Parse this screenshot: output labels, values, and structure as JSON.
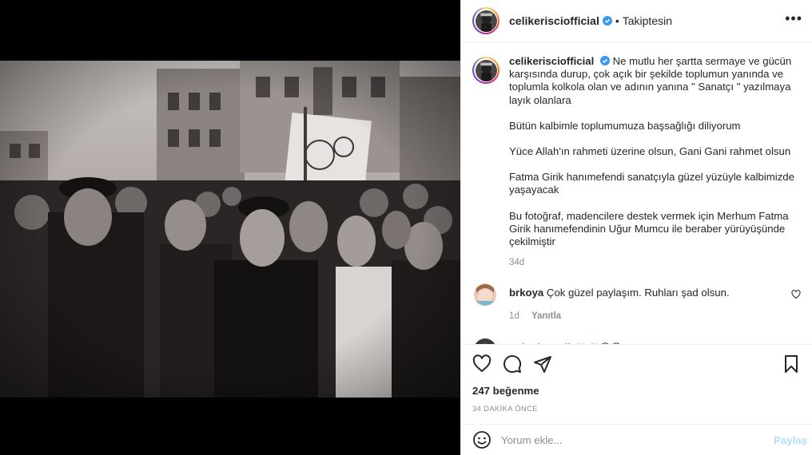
{
  "post": {
    "username": "celikerisciofficial",
    "verified": true,
    "follow_status": "Takiptesin",
    "more_icon": "more-horizontal-icon"
  },
  "caption": {
    "username": "celikerisciofficial",
    "first_line": "Ne mutlu her şartta sermaye ve gücün karşısında durup, çok açık bir şekilde toplumun yanında ve toplumla kolkola olan ve adının yanına \" Sanatçı \" yazılmaya layık olanlara",
    "paragraphs": [
      "Bütün kalbimle toplumumuza başsağlığı diliyorum",
      "Yüce Allah'ın rahmeti üzerine olsun, Gani Gani rahmet olsun",
      "Fatma Girik hanımefendi sanatçıyla güzel yüzüyle kalbimizde yaşayacak",
      "Bu fotoğraf, madencilere destek vermek için Merhum Fatma Girik hanımefendinin Uğur Mumcu ile beraber yürüyüşünde çekilmiştir"
    ],
    "time": "34d"
  },
  "comments": [
    {
      "username": "brkoya",
      "text": "Çok güzel paylaşım. Ruhları şad olsun.",
      "time": "1d",
      "reply": "Yanıtla"
    },
    {
      "username": "nuketbozatli",
      "text": "👏👏😢😢",
      "time": "",
      "reply": ""
    }
  ],
  "actions": {
    "likes": "247 beğenme",
    "time_ago": "34 DAKİKA ÖNCE"
  },
  "add_comment": {
    "placeholder": "Yorum ekle...",
    "post_label": "Paylaş"
  },
  "colors": {
    "verified": "#3897f0",
    "muted": "#8e8e8e",
    "post_disabled": "#b2dffc",
    "border": "#efefef"
  }
}
